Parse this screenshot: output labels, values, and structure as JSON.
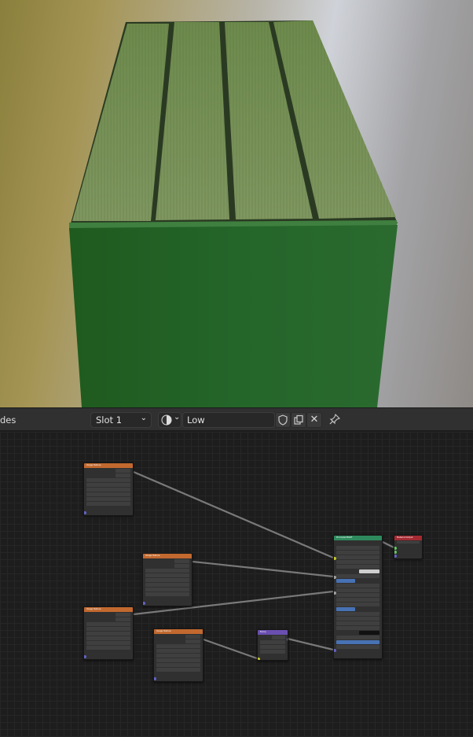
{
  "header": {
    "editor_type_label": "des",
    "slot_select": "Slot 1",
    "material_name": "Low",
    "icons": [
      "material-sphere-icon",
      "shield-icon",
      "duplicate-icon",
      "close-icon",
      "pin-icon"
    ]
  },
  "nodes": {
    "image_texture": {
      "title": "Image Texture",
      "file_label": "Fallback_Box_Low",
      "outputs": [
        "Color",
        "Alpha"
      ],
      "fields": [
        "Linear",
        "Flat",
        "Repeat",
        "Single Image",
        "Color Space"
      ]
    },
    "bump": {
      "title": "Bump"
    },
    "principled": {
      "title": "Principled BSDF",
      "output": "BSDF"
    },
    "output": {
      "title": "Material Output",
      "target": "All",
      "inputs": [
        "Surface",
        "Volume",
        "Displacement"
      ]
    }
  },
  "colors": {
    "image_node_header": "#c2692f",
    "bsdf_node_header": "#2e8a5d",
    "output_node_header": "#a52a32",
    "bump_node_header": "#6a4fb0",
    "socket_color": "#c7c729",
    "socket_vector": "#6363c7",
    "socket_shader": "#63c763",
    "link": "#8a8a8a"
  }
}
